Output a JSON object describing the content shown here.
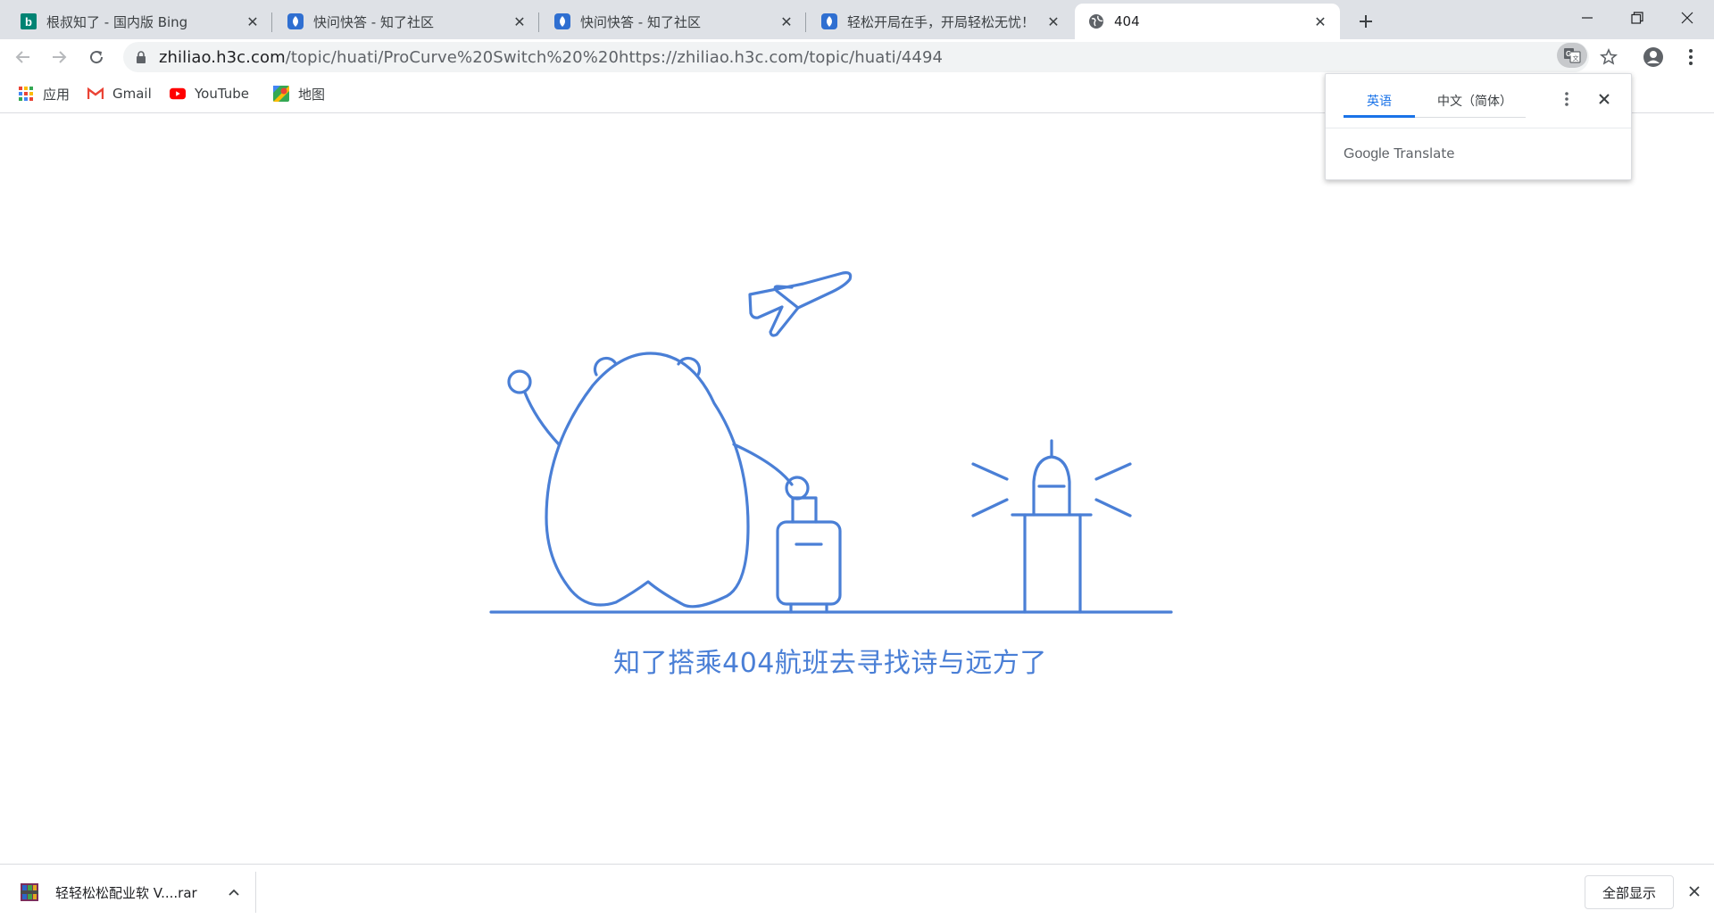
{
  "tabs": [
    {
      "title": "根叔知了 - 国内版 Bing",
      "icon": "bing-icon",
      "active": false
    },
    {
      "title": "快问快答 - 知了社区",
      "icon": "zhiliao-icon",
      "active": false
    },
    {
      "title": "快问快答 - 知了社区",
      "icon": "zhiliao-icon",
      "active": false
    },
    {
      "title": "轻松开局在手，开局轻松无忧！",
      "icon": "zhiliao-icon",
      "active": false
    },
    {
      "title": "404",
      "icon": "globe-icon",
      "active": true
    }
  ],
  "address_bar": {
    "host": "zhiliao.h3c.com",
    "path": "/topic/huati/ProCurve%20Switch%20%20https://zhiliao.h3c.com/topic/huati/4494"
  },
  "bookmarks": [
    {
      "label": "应用",
      "icon": "apps-grid-icon"
    },
    {
      "label": "Gmail",
      "icon": "gmail-icon"
    },
    {
      "label": "YouTube",
      "icon": "youtube-icon"
    },
    {
      "label": "地图",
      "icon": "maps-icon"
    }
  ],
  "translate_popup": {
    "source_lang": "英语",
    "target_lang": "中文（简体）",
    "brand_google": "Google",
    "brand_translate": "Translate"
  },
  "page": {
    "message": "知了搭乘404航班去寻找诗与远方了"
  },
  "downloads": {
    "file_name": "轻轻松松配业软 V....rar",
    "show_all_label": "全部显示"
  },
  "colors": {
    "illustration": "#4a7fd6",
    "accent": "#1a73e8",
    "tabstrip": "#dee1e6"
  }
}
